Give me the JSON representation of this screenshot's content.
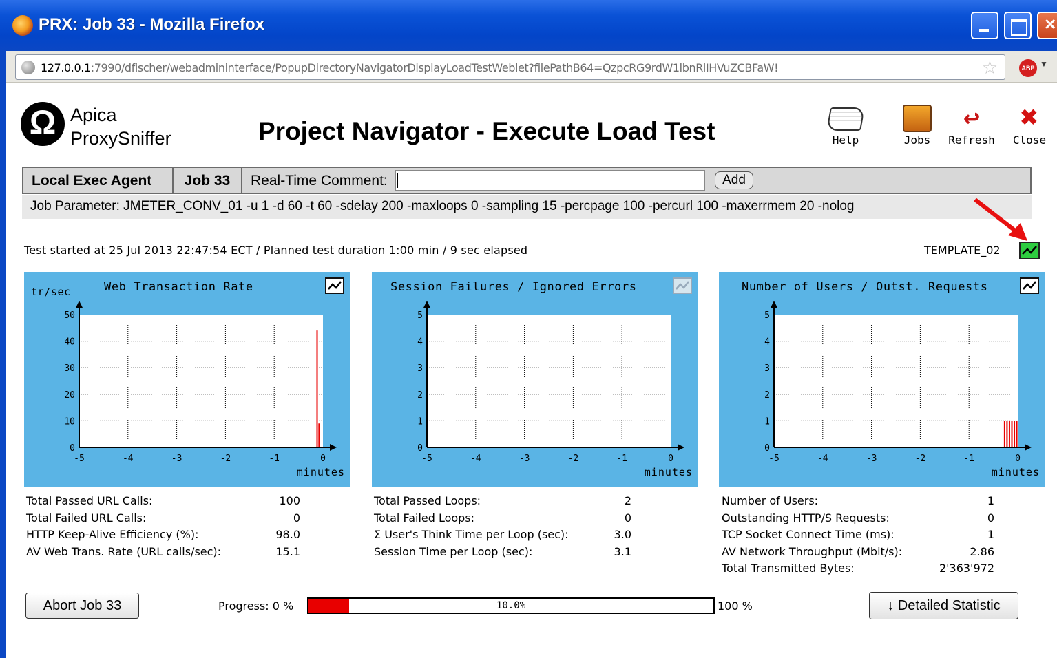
{
  "window": {
    "title": "PRX: Job 33 - Mozilla Firefox"
  },
  "address": {
    "url_host": "127.0.0.1",
    "url_rest": ":7990/dfischer/webadmininterface/PopupDirectoryNavigatorDisplayLoadTestWeblet?filePathB64=QzpcRG9rdW1lbnRlIHVuZCBFaW!",
    "abp_label": "ABP"
  },
  "header": {
    "logo_line1": "Apica",
    "logo_line2": "ProxySniffer",
    "title": "Project Navigator - Execute Load Test",
    "tools": {
      "help": "Help",
      "jobs": "Jobs",
      "refresh": "Refresh",
      "close": "Close"
    }
  },
  "agentbar": {
    "agent": "Local Exec Agent",
    "job": "Job 33",
    "comment_label": "Real-Time Comment:",
    "comment_value": "",
    "add_label": "Add"
  },
  "job_parameter": "Job Parameter: JMETER_CONV_01 -u 1 -d 60 -t 60 -sdelay 200 -maxloops 0 -sampling 15 -percpage 100 -percurl 100 -maxerrmem 20 -nolog",
  "test_status": "Test started at 25 Jul 2013 22:47:54 ECT  /  Planned test duration 1:00 min  /  9 sec elapsed",
  "template": "TEMPLATE_02",
  "charts": [
    {
      "title": "Web Transaction Rate",
      "ylabel": "tr/sec",
      "xlabel": "minutes",
      "yticks": [
        "50",
        "40",
        "30",
        "20",
        "10",
        "0"
      ],
      "xticks": [
        "-5",
        "-4",
        "-3",
        "-2",
        "-1",
        "0"
      ],
      "ymax": 50,
      "bars": [
        {
          "x": -0.12,
          "y": 44
        },
        {
          "x": -0.08,
          "y": 9
        }
      ]
    },
    {
      "title": "Session Failures / Ignored Errors",
      "ylabel": "",
      "xlabel": "minutes",
      "yticks": [
        "5",
        "4",
        "3",
        "2",
        "1",
        "0"
      ],
      "xticks": [
        "-5",
        "-4",
        "-3",
        "-2",
        "-1",
        "0"
      ],
      "ymax": 5,
      "bars": []
    },
    {
      "title": "Number of Users / Outst. Requests",
      "ylabel": "",
      "xlabel": "minutes",
      "yticks": [
        "5",
        "4",
        "3",
        "2",
        "1",
        "0"
      ],
      "xticks": [
        "-5",
        "-4",
        "-3",
        "-2",
        "-1",
        "0"
      ],
      "ymax": 5,
      "bars": [
        {
          "x": -0.27,
          "y": 1
        },
        {
          "x": -0.22,
          "y": 1
        },
        {
          "x": -0.17,
          "y": 1
        },
        {
          "x": -0.12,
          "y": 1
        },
        {
          "x": -0.07,
          "y": 1
        },
        {
          "x": -0.02,
          "y": 1
        }
      ]
    }
  ],
  "stats": [
    [
      {
        "label": "Total Passed URL Calls:",
        "value": "100"
      },
      {
        "label": "Total Failed URL Calls:",
        "value": "0"
      },
      {
        "label": "HTTP Keep-Alive Efficiency (%):",
        "value": "98.0"
      },
      {
        "label": "AV Web Trans. Rate (URL calls/sec):",
        "value": "15.1"
      }
    ],
    [
      {
        "label": "Total Passed Loops:",
        "value": "2"
      },
      {
        "label": "Total Failed Loops:",
        "value": "0"
      },
      {
        "label": "Σ User's Think Time per Loop (sec):",
        "value": "3.0"
      },
      {
        "label": "Session Time per Loop (sec):",
        "value": "3.1"
      }
    ],
    [
      {
        "label": "Number of Users:",
        "value": "1"
      },
      {
        "label": "Outstanding HTTP/S Requests:",
        "value": "0"
      },
      {
        "label": "TCP Socket Connect Time (ms):",
        "value": "1"
      },
      {
        "label": "AV Network Throughput (Mbit/s):",
        "value": "2.86"
      },
      {
        "label": "Total Transmitted Bytes:",
        "value": "2'363'972"
      }
    ]
  ],
  "controls": {
    "abort_label": "Abort Job 33",
    "progress_label": "Progress: 0 %",
    "progress_value": "10.0%",
    "progress_fraction": 0.1,
    "progress_max": "100 %",
    "detail_label": "↓ Detailed Statistic"
  },
  "colors": {
    "chart_bg": "#5ab4e5",
    "bar": "#e80000",
    "accent": "#2ecc40"
  }
}
